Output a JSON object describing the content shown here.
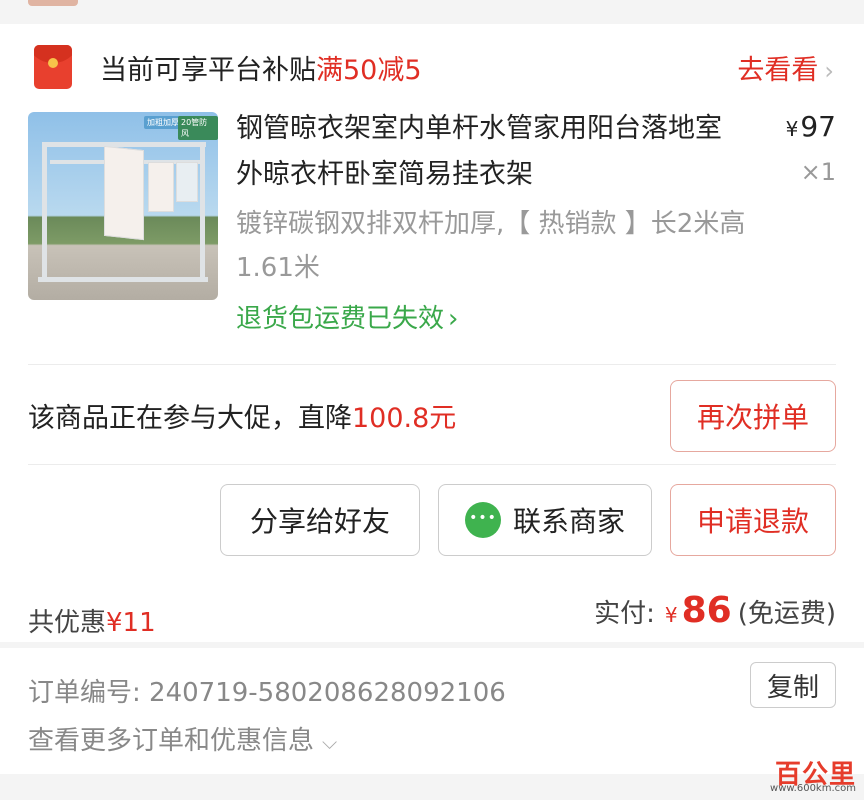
{
  "subsidy": {
    "text": "当前可享平台补贴",
    "highlight": "满50减5",
    "link_label": "去看看",
    "chevron": "›"
  },
  "product": {
    "title": "钢管晾衣架室内单杆水管家用阳台落地室外晾衣杆卧室简易挂衣架",
    "price_symbol": "¥",
    "price": "97",
    "quantity": "×1",
    "spec": "镀锌碳钢双排双杆加厚,【 热销款 】长2米高1.61米",
    "refund_status": "退货包运费已失效",
    "refund_chevron": "›",
    "image_tags": [
      "加粗加厚",
      "20管防风"
    ]
  },
  "promo": {
    "text": "该商品正在参与大促，直降",
    "highlight": "100.8元",
    "regroup_label": "再次拼单"
  },
  "actions": {
    "share_label": "分享给好友",
    "contact_label": "联系商家",
    "refund_label": "申请退款"
  },
  "totals": {
    "discount_label": "共优惠",
    "discount_value": "¥11",
    "paid_label": "实付:",
    "paid_symbol": "¥",
    "paid_amount": "86",
    "shipping_note": "(免运费)"
  },
  "order": {
    "number_label": "订单编号: 240719-580208628092106",
    "copy_label": "复制",
    "more_info": "查看更多订单和优惠信息",
    "more_chevron": "⌵"
  },
  "watermark": {
    "brand": "百公里",
    "url": "www.600km.com"
  },
  "colors": {
    "accent_red": "#e02e24",
    "success_green": "#3aa84a",
    "chat_green": "#3fb34f"
  },
  "icons": {
    "subsidy": "red-packet-icon",
    "contact": "chat-bubble-icon"
  }
}
